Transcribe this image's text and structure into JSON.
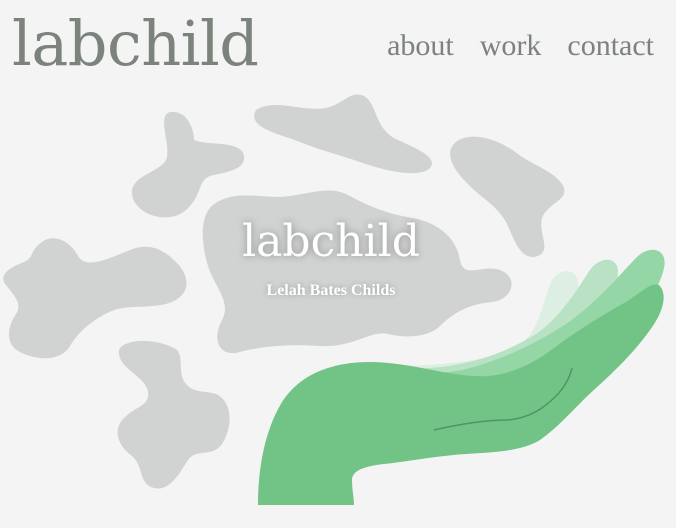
{
  "header": {
    "logo": "labchild",
    "nav": {
      "about": "about",
      "work": "work",
      "contact": "contact"
    }
  },
  "hero": {
    "title": "labchild",
    "subtitle": "Lelah Bates Childs"
  },
  "colors": {
    "background": "#f4f4f4",
    "text": "#7b837c",
    "blob": "#d0d3d1",
    "hand": "#72c486"
  }
}
